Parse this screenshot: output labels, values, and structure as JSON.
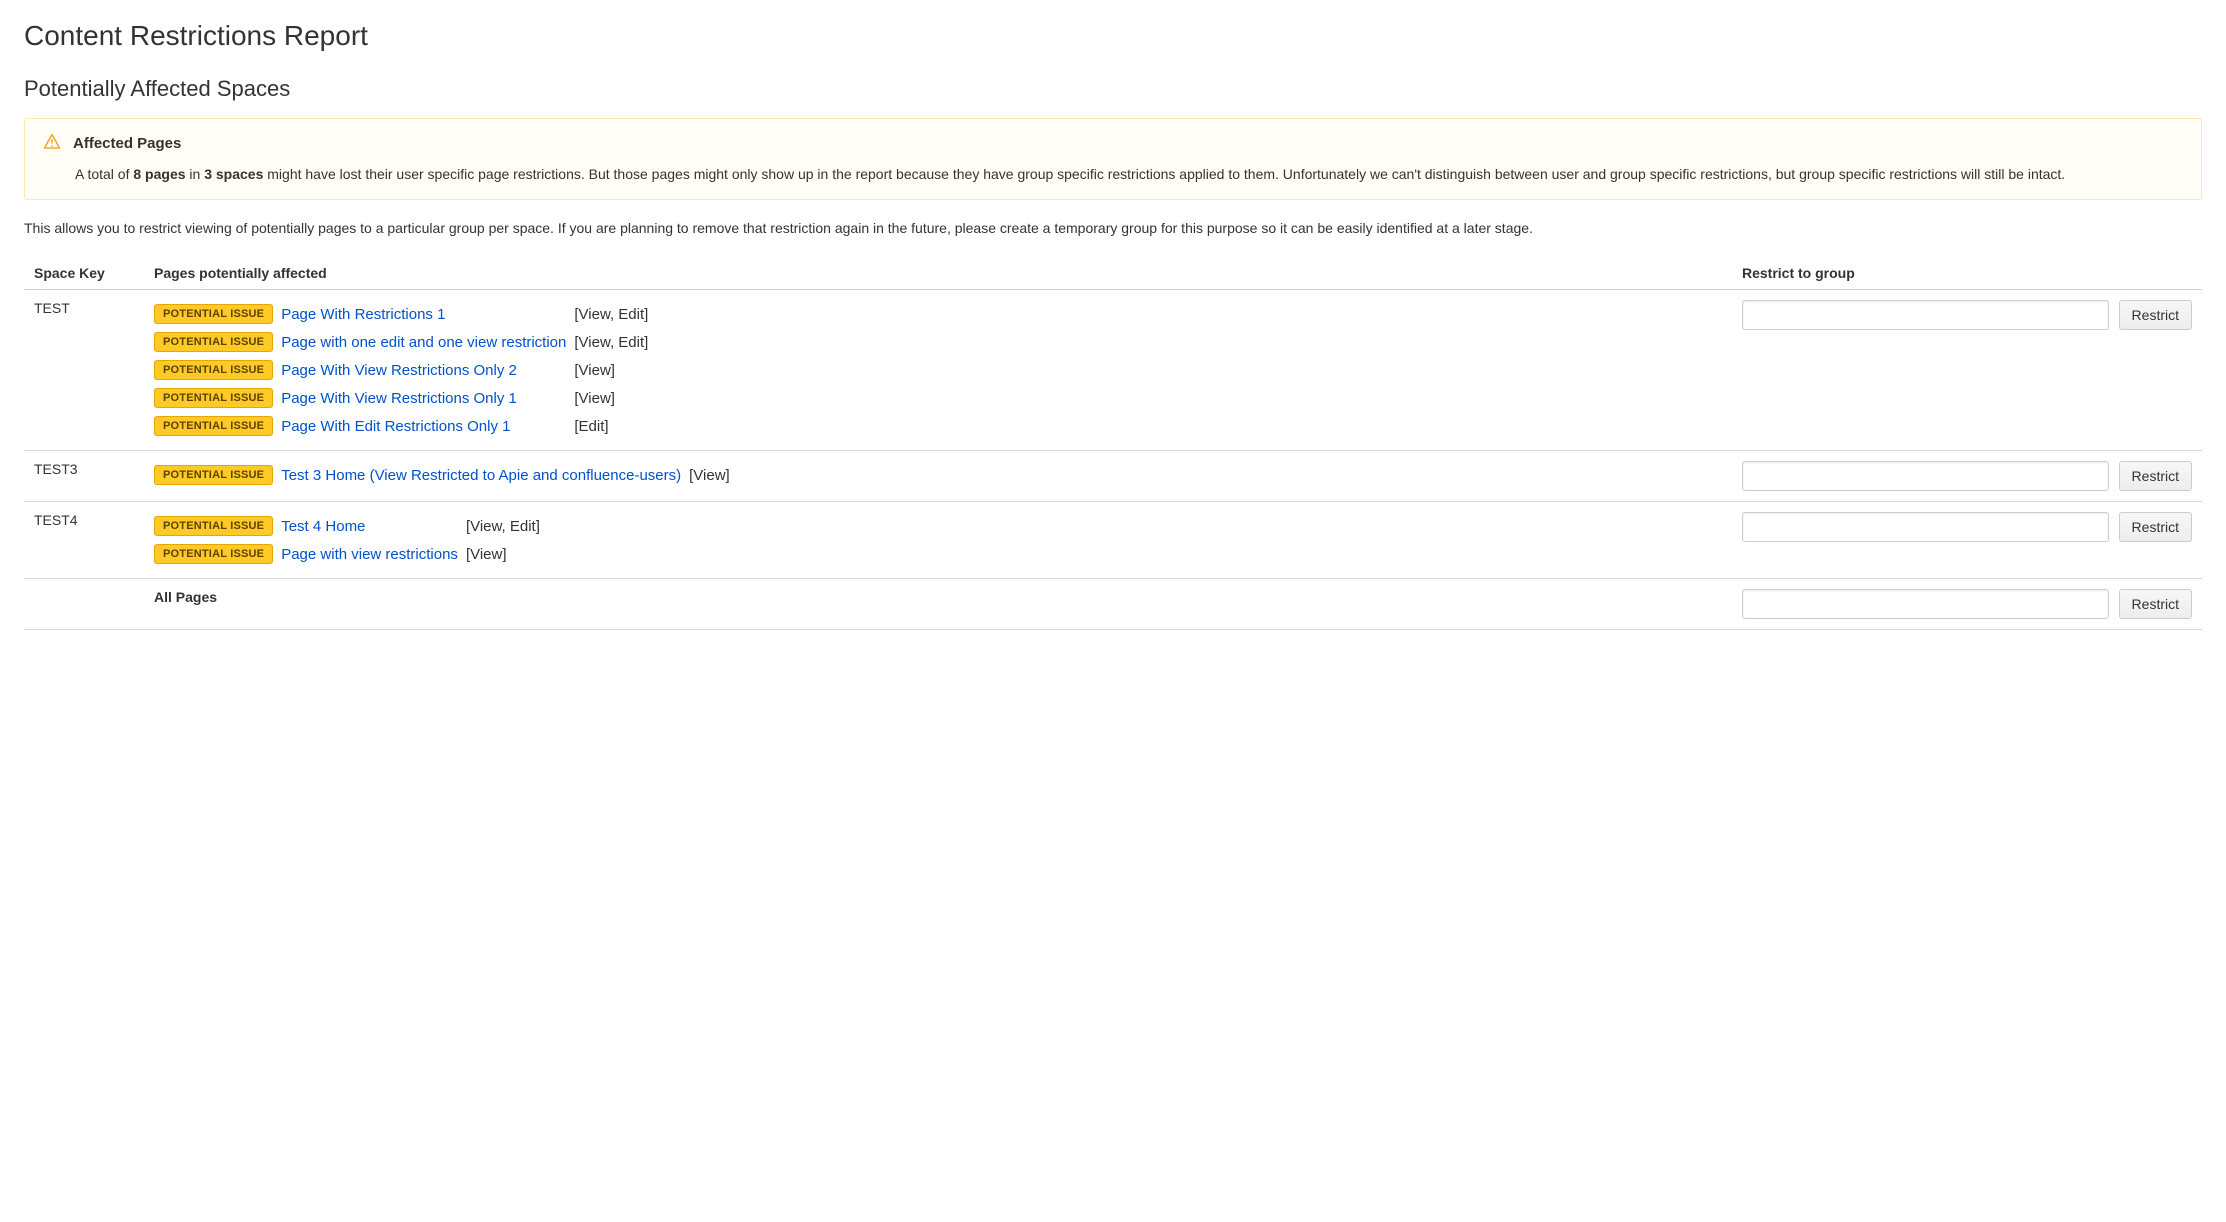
{
  "title": "Content Restrictions Report",
  "subtitle": "Potentially Affected Spaces",
  "warning": {
    "heading": "Affected Pages",
    "body_pre": "A total of ",
    "pages_bold": "8 pages",
    "body_mid1": " in ",
    "spaces_bold": "3 spaces",
    "body_post": " might have lost their user specific page restrictions. But those pages might only show up in the report because they have group specific restrictions applied to them. Unfortunately we can't distinguish between user and group specific restrictions, but group specific restrictions will still be intact."
  },
  "intro": "This allows you to restrict viewing of potentially pages to a particular group per space. If you are planning to remove that restriction again in the future, please create a temporary group for this purpose so it can be easily identified at a later stage.",
  "columns": {
    "space_key": "Space Key",
    "pages": "Pages potentially affected",
    "restrict": "Restrict to group"
  },
  "lozenge_label": "POTENTIAL ISSUE",
  "restrict_button_label": "Restrict",
  "restrict_input_value": "",
  "all_pages_label": "All Pages",
  "spaces": [
    {
      "key": "TEST",
      "pages": [
        {
          "title": "Page With Restrictions 1",
          "perms": "[View, Edit]"
        },
        {
          "title": "Page with one edit and one view restriction",
          "perms": "[View, Edit]"
        },
        {
          "title": "Page With View Restrictions Only 2",
          "perms": "[View]"
        },
        {
          "title": "Page With View Restrictions Only 1",
          "perms": "[View]"
        },
        {
          "title": "Page With Edit Restrictions Only 1",
          "perms": "[Edit]"
        }
      ]
    },
    {
      "key": "TEST3",
      "pages": [
        {
          "title": "Test 3 Home (View Restricted to Apie and confluence-users)",
          "perms": "[View]"
        }
      ]
    },
    {
      "key": "TEST4",
      "pages": [
        {
          "title": "Test 4 Home",
          "perms": "[View, Edit]"
        },
        {
          "title": "Page with view restrictions",
          "perms": "[View]"
        }
      ]
    }
  ]
}
